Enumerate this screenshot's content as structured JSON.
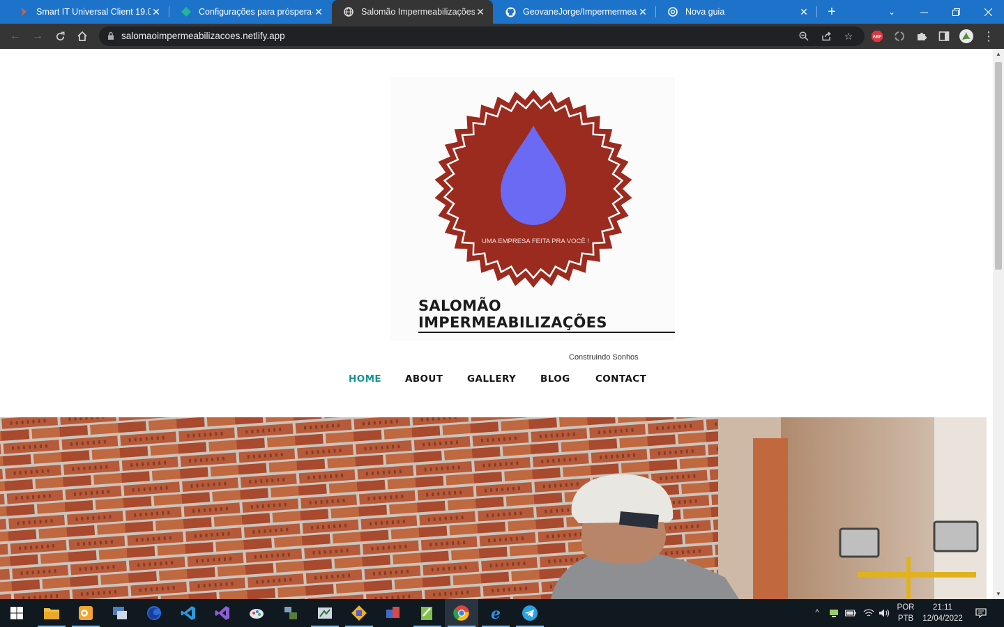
{
  "tabs": [
    {
      "title": "Smart IT Universal Client 19.08",
      "favicon": "smartit-icon"
    },
    {
      "title": "Configurações para próspera-pi",
      "favicon": "diamond-icon"
    },
    {
      "title": "Salomão Impermeabilizações",
      "favicon": "globe-icon"
    },
    {
      "title": "GeovaneJorge/Impermermeabil",
      "favicon": "github-icon"
    },
    {
      "title": "Nova guia",
      "favicon": "chrome-icon"
    }
  ],
  "toolbar": {
    "url": "salomaoimpermeabilizacoes.netlify.app"
  },
  "site": {
    "logo_badge_text": "UMA EMPRESA FEITA PRA  VOCÊ !",
    "logo_title": "SALOMÃO IMPERMEABILIZAÇÕES",
    "logo_subtitle": "Construindo Sonhos",
    "nav": [
      "HOME",
      "ABOUT",
      "GALLERY",
      "BLOG",
      "CONTACT"
    ],
    "active_nav": "HOME"
  },
  "colors": {
    "chrome_tabstrip": "#1d73c9",
    "chrome_toolbar": "#353535",
    "nav_active": "#149496",
    "badge_red": "#9b2a1f",
    "drop_blue": "#6a6af5"
  },
  "taskbar": {
    "lang": "POR",
    "lang_sub": "PTB",
    "time": "21:11",
    "date": "12/04/2022"
  }
}
